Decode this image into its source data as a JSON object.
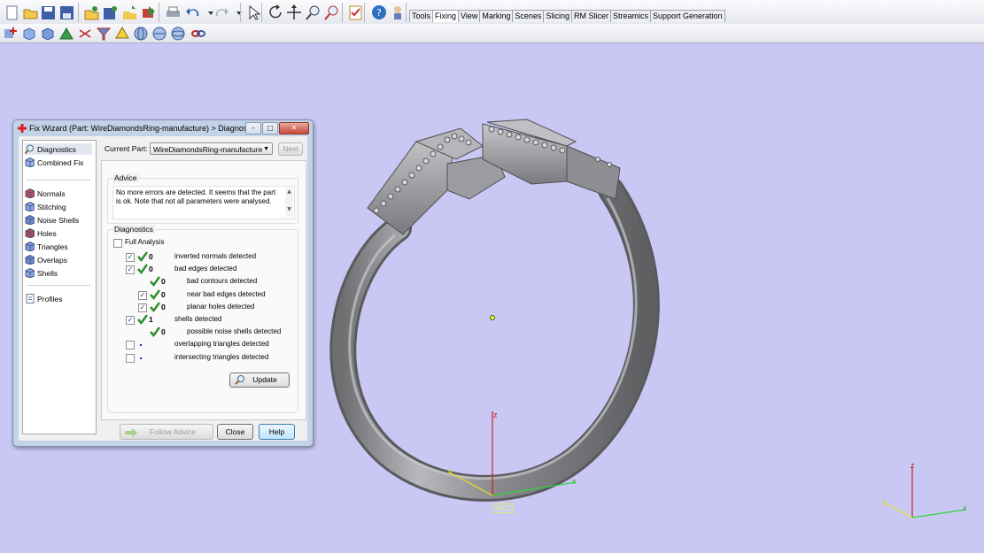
{
  "toolbar": {
    "row1_icons": [
      "new-file-icon",
      "open-folder-icon",
      "save-icon",
      "save-as-icon",
      "open-project-icon",
      "save-project-icon",
      "import-icon",
      "export-icon",
      "print-icon",
      "undo-icon",
      "undo-dropdown-icon",
      "redo-icon",
      "redo-dropdown-icon",
      "select-icon",
      "rotate-icon",
      "pan-icon",
      "zoom-icon",
      "zoom-box-icon",
      "checklist-icon",
      "help-icon",
      "wizard-icon"
    ],
    "row2_icons": [
      "fix-wizard-icon",
      "unify-icon",
      "stitch-icon",
      "triangle-icon",
      "cut-icon",
      "filter-icon",
      "extrude-icon",
      "wrap-icon",
      "sphere-icon",
      "globe-icon",
      "link-icon"
    ],
    "tabs": [
      "Tools",
      "Fixing",
      "View",
      "Marking",
      "Scenes",
      "Slicing",
      "RM Slicer",
      "Streamics",
      "Support Generation"
    ],
    "active_tab": "Fixing"
  },
  "dialog": {
    "title": "Fix Wizard (Part: WireDiamondsRing-manufacture) > Diagnos...",
    "nav": {
      "top": [
        {
          "label": "Diagnostics",
          "icon": "magnifier-icon",
          "selected": true
        },
        {
          "label": "Combined Fix",
          "icon": "combined-fix-icon",
          "selected": false
        }
      ],
      "fixes": [
        {
          "label": "Normals",
          "icon": "normals-icon"
        },
        {
          "label": "Stitching",
          "icon": "stitching-icon"
        },
        {
          "label": "Noise Shells",
          "icon": "noise-shells-icon"
        },
        {
          "label": "Holes",
          "icon": "holes-icon"
        },
        {
          "label": "Triangles",
          "icon": "triangles-icon"
        },
        {
          "label": "Overlaps",
          "icon": "overlaps-icon"
        },
        {
          "label": "Shells",
          "icon": "shells-icon"
        }
      ],
      "bottom": [
        {
          "label": "Profiles",
          "icon": "profiles-icon"
        }
      ]
    },
    "current_part_label": "Current Part:",
    "current_part_value": "WireDiamondsRing-manufacture",
    "next_label": "Next",
    "advice_title": "Advice",
    "advice_text": "No more errors are detected. It seems that the part is ok. Note that not all parameters were analysed.",
    "diagnostics_title": "Diagnostics",
    "full_analysis_label": "Full Analysis",
    "diagnostics": [
      {
        "checkbox": true,
        "checked": true,
        "status": "ok",
        "value": "0",
        "label": "inverted normals detected",
        "indent": 0
      },
      {
        "checkbox": true,
        "checked": true,
        "status": "ok",
        "value": "0",
        "label": "bad edges detected",
        "indent": 0
      },
      {
        "checkbox": false,
        "checked": false,
        "status": "ok",
        "value": "0",
        "label": "bad contours detected",
        "indent": 1
      },
      {
        "checkbox": true,
        "checked": true,
        "status": "ok",
        "value": "0",
        "label": "near bad edges detected",
        "indent": 1
      },
      {
        "checkbox": true,
        "checked": true,
        "status": "ok",
        "value": "0",
        "label": "planar holes detected",
        "indent": 1
      },
      {
        "checkbox": true,
        "checked": true,
        "status": "ok",
        "value": "1",
        "label": "shells detected",
        "indent": 0
      },
      {
        "checkbox": false,
        "checked": false,
        "status": "ok",
        "value": "0",
        "label": "possible noise shells detected",
        "indent": 1
      },
      {
        "checkbox": true,
        "checked": false,
        "status": "none",
        "value": "",
        "label": "overlapping triangles detected",
        "indent": 0
      },
      {
        "checkbox": true,
        "checked": false,
        "status": "none",
        "value": "",
        "label": "intersecting triangles detected",
        "indent": 0
      }
    ],
    "update_label": "Update",
    "follow_advice_label": "Follow Advice",
    "close_label": "Close",
    "help_label": "Help"
  },
  "viewport": {
    "wcs_label": "WCS",
    "axis_z": "z",
    "axis_y": "y",
    "axis_x": "x",
    "background": "#c9c8f4"
  }
}
